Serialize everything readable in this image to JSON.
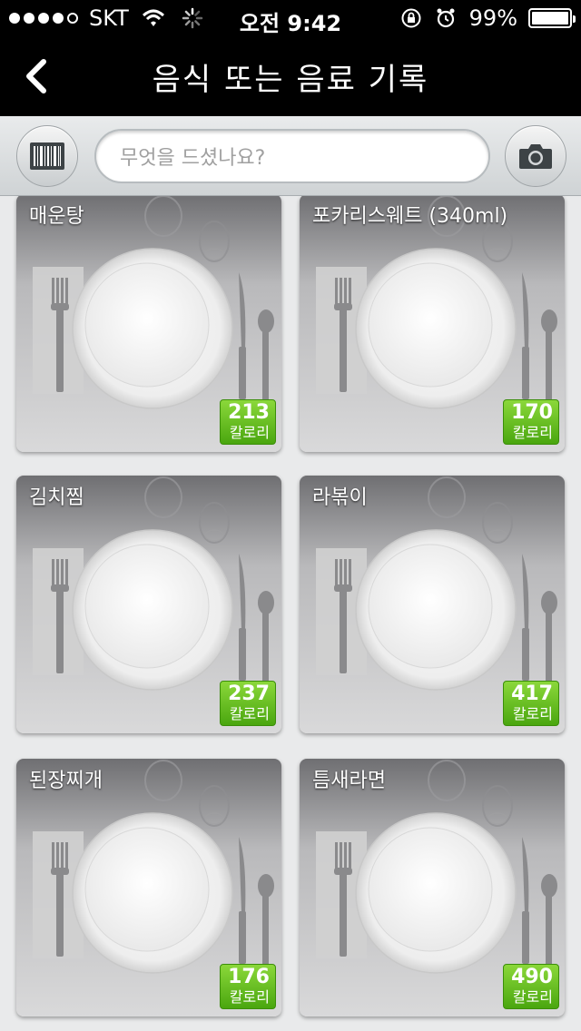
{
  "status_bar": {
    "carrier": "SKT",
    "time": "오전 9:42",
    "battery": "99%",
    "battery_level": 0.99
  },
  "nav": {
    "title": "음식 또는 음료 기록"
  },
  "search": {
    "placeholder": "무엇을 드셨나요?"
  },
  "foods": [
    {
      "name": "매운탕",
      "calories": "213",
      "unit": "칼로리"
    },
    {
      "name": "포카리스웨트 (340ml)",
      "calories": "170",
      "unit": "칼로리"
    },
    {
      "name": "김치찜",
      "calories": "237",
      "unit": "칼로리"
    },
    {
      "name": "라볶이",
      "calories": "417",
      "unit": "칼로리"
    },
    {
      "name": "된장찌개",
      "calories": "176",
      "unit": "칼로리"
    },
    {
      "name": "틈새라면",
      "calories": "490",
      "unit": "칼로리"
    }
  ],
  "colors": {
    "accent_green": "#6cc222",
    "nav_background": "#000000"
  }
}
